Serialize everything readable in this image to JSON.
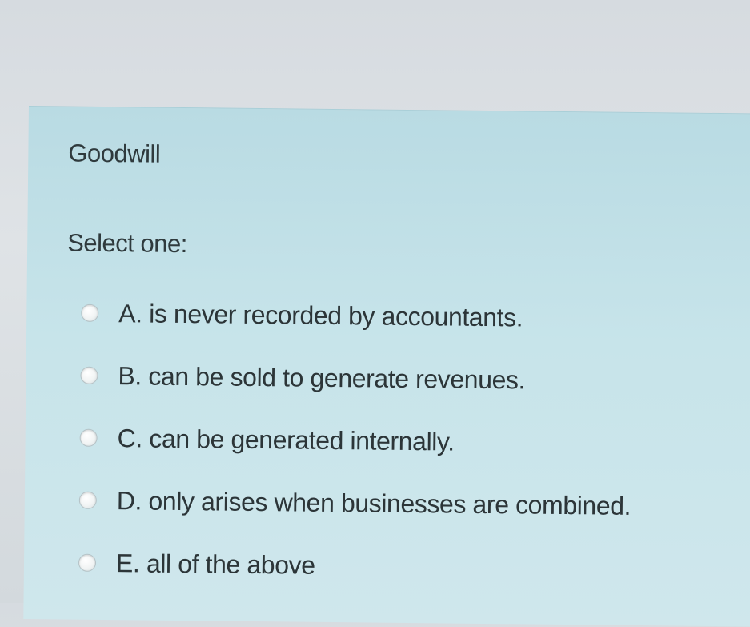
{
  "question": {
    "title": "Goodwill",
    "prompt": "Select one:",
    "options": [
      {
        "letter": "A",
        "label": "A. is never recorded by accountants."
      },
      {
        "letter": "B",
        "label": "B. can be sold to generate revenues."
      },
      {
        "letter": "C",
        "label": "C. can be generated internally."
      },
      {
        "letter": "D",
        "label": "D. only arises when businesses are combined."
      },
      {
        "letter": "E",
        "label": "E. all of the above"
      }
    ]
  },
  "colors": {
    "panel_background": "#c3e1e8",
    "page_background": "#dcdfe2",
    "text": "#2f3a3d"
  }
}
